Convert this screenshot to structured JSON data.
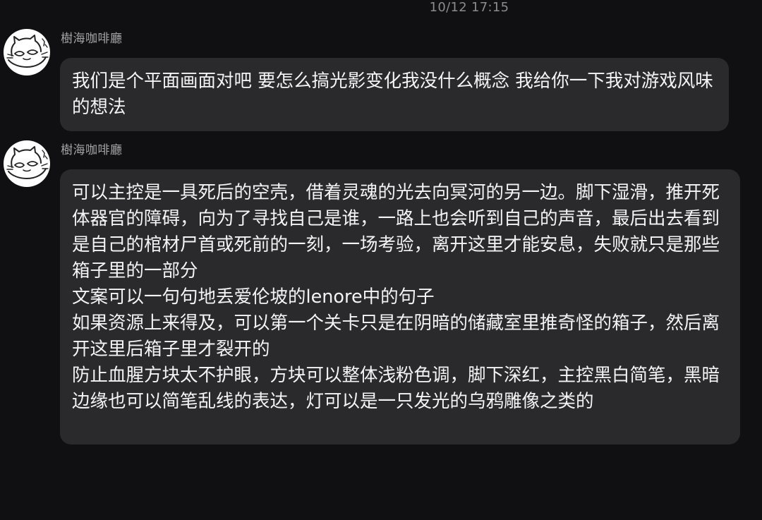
{
  "timestamp": "10/12 17:15",
  "colors": {
    "background": "#101012",
    "bubble": "#2a2a2c",
    "sender_text": "#a4a4a8",
    "timestamp_text": "#8b8b90",
    "message_text": "#f4f4f4"
  },
  "messages": [
    {
      "sender": "樹海咖啡廳",
      "avatar_icon": "cat-face-avatar-icon",
      "text": "我们是个平面画面对吧 要怎么搞光影变化我没什么概念 我给你一下我对游戏风味的想法"
    },
    {
      "sender": "樹海咖啡廳",
      "avatar_icon": "cat-face-avatar-icon",
      "text": "可以主控是一具死后的空壳，借着灵魂的光去向冥河的另一边。脚下湿滑，推开死体器官的障碍，向为了寻找自己是谁，一路上也会听到自己的声音，最后出去看到是自己的棺材尸首或死前的一刻，一场考验，离开这里才能安息，失败就只是那些箱子里的一部分\n文案可以一句句地丢爱伦坡的lenore中的句子\n如果资源上来得及，可以第一个关卡只是在阴暗的储藏室里推奇怪的箱子，然后离开这里后箱子里才裂开的\n防止血腥方块太不护眼，方块可以整体浅粉色调，脚下深红，主控黑白简笔，黑暗边缘也可以简笔乱线的表达，灯可以是一只发光的乌鸦雕像之类的"
    }
  ]
}
